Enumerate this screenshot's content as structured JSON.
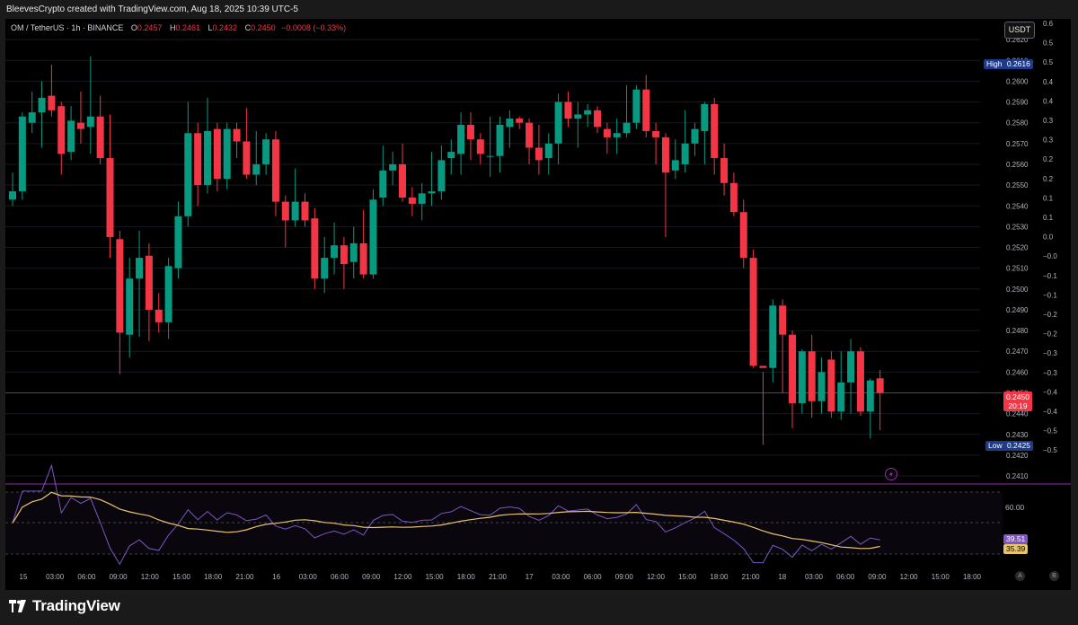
{
  "header": {
    "text": "BleevesCrypto created with TradingView.com, Aug 18, 2025 10:39 UTC-5"
  },
  "legend": {
    "symbol": "OM / TetherUS · 1h · BINANCE",
    "open_key": "O",
    "open": "0.2457",
    "high_key": "H",
    "high": "0.2461",
    "low_key": "L",
    "low": "0.2432",
    "close_key": "C",
    "close": "0.2450",
    "change": "−0.0008 (−0.33%)"
  },
  "currency_button": "USDT",
  "tags": {
    "high_label": "High",
    "high_value": "0.2616",
    "low_label": "Low",
    "low_value": "0.2425",
    "last_price": "0.2450",
    "countdown": "20:19",
    "rsi_value": "39.51",
    "rsi_ma_value": "35.39",
    "rsi_level": "60.00"
  },
  "price_axis": [
    "0.2620",
    "0.2610",
    "0.2600",
    "0.2590",
    "0.2580",
    "0.2570",
    "0.2560",
    "0.2550",
    "0.2540",
    "0.2530",
    "0.2520",
    "0.2510",
    "0.2500",
    "0.2490",
    "0.2480",
    "0.2470",
    "0.2460",
    "0.2450",
    "0.2440",
    "0.2430",
    "0.2420",
    "0.2410"
  ],
  "right_axis": [
    "0.6",
    "0.5",
    "0.5",
    "0.4",
    "0.4",
    "0.3",
    "0.3",
    "0.2",
    "0.2",
    "0.1",
    "0.1",
    "0.0",
    "−0.0",
    "−0.1",
    "−0.1",
    "−0.2",
    "−0.2",
    "−0.3",
    "−0.3",
    "−0.4",
    "−0.4",
    "−0.5",
    "−0.5"
  ],
  "time_axis": [
    "15",
    "03:00",
    "06:00",
    "09:00",
    "12:00",
    "15:00",
    "18:00",
    "21:00",
    "16",
    "03:00",
    "06:00",
    "09:00",
    "12:00",
    "15:00",
    "18:00",
    "21:00",
    "17",
    "03:00",
    "06:00",
    "09:00",
    "12:00",
    "15:00",
    "18:00",
    "21:00",
    "18",
    "03:00",
    "06:00",
    "09:00",
    "12:00",
    "15:00",
    "18:00"
  ],
  "bottom_buttons": [
    "A",
    "B"
  ],
  "brand": "TradingView",
  "colors": {
    "up": "#089981",
    "down": "#f23645",
    "rsi": "#7e57c2",
    "rsi_ma": "#e9c46a"
  },
  "chart_data": {
    "type": "candlestick",
    "interval": "1h",
    "candles": [
      {
        "o": 0.2543,
        "h": 0.2556,
        "l": 0.254,
        "c": 0.2547
      },
      {
        "o": 0.2547,
        "h": 0.2585,
        "l": 0.2543,
        "c": 0.2583
      },
      {
        "o": 0.258,
        "h": 0.2595,
        "l": 0.2575,
        "c": 0.2585
      },
      {
        "o": 0.2585,
        "h": 0.26,
        "l": 0.2568,
        "c": 0.2592
      },
      {
        "o": 0.2593,
        "h": 0.2608,
        "l": 0.2583,
        "c": 0.2586
      },
      {
        "o": 0.2588,
        "h": 0.259,
        "l": 0.2555,
        "c": 0.2565
      },
      {
        "o": 0.2566,
        "h": 0.2588,
        "l": 0.2562,
        "c": 0.2581
      },
      {
        "o": 0.258,
        "h": 0.2595,
        "l": 0.257,
        "c": 0.2577
      },
      {
        "o": 0.2578,
        "h": 0.2612,
        "l": 0.2565,
        "c": 0.2583
      },
      {
        "o": 0.2583,
        "h": 0.2593,
        "l": 0.256,
        "c": 0.2563
      },
      {
        "o": 0.2563,
        "h": 0.2584,
        "l": 0.2515,
        "c": 0.2525
      },
      {
        "o": 0.2524,
        "h": 0.2528,
        "l": 0.2459,
        "c": 0.2479
      },
      {
        "o": 0.2478,
        "h": 0.2515,
        "l": 0.2467,
        "c": 0.2505
      },
      {
        "o": 0.2505,
        "h": 0.2528,
        "l": 0.2477,
        "c": 0.2515
      },
      {
        "o": 0.2516,
        "h": 0.2522,
        "l": 0.2475,
        "c": 0.249
      },
      {
        "o": 0.249,
        "h": 0.2498,
        "l": 0.2479,
        "c": 0.2484
      },
      {
        "o": 0.2484,
        "h": 0.2515,
        "l": 0.2476,
        "c": 0.2511
      },
      {
        "o": 0.251,
        "h": 0.2542,
        "l": 0.2505,
        "c": 0.2535
      },
      {
        "o": 0.2535,
        "h": 0.259,
        "l": 0.253,
        "c": 0.2575
      },
      {
        "o": 0.2575,
        "h": 0.258,
        "l": 0.254,
        "c": 0.255
      },
      {
        "o": 0.255,
        "h": 0.2592,
        "l": 0.2546,
        "c": 0.2576
      },
      {
        "o": 0.2577,
        "h": 0.258,
        "l": 0.2547,
        "c": 0.2553
      },
      {
        "o": 0.2553,
        "h": 0.258,
        "l": 0.2548,
        "c": 0.2577
      },
      {
        "o": 0.2577,
        "h": 0.258,
        "l": 0.2563,
        "c": 0.2571
      },
      {
        "o": 0.2571,
        "h": 0.2587,
        "l": 0.2553,
        "c": 0.2555
      },
      {
        "o": 0.2555,
        "h": 0.2576,
        "l": 0.255,
        "c": 0.256
      },
      {
        "o": 0.256,
        "h": 0.2575,
        "l": 0.2555,
        "c": 0.2572
      },
      {
        "o": 0.2572,
        "h": 0.2576,
        "l": 0.2535,
        "c": 0.2542
      },
      {
        "o": 0.2542,
        "h": 0.2545,
        "l": 0.252,
        "c": 0.2533
      },
      {
        "o": 0.2533,
        "h": 0.2558,
        "l": 0.253,
        "c": 0.2542
      },
      {
        "o": 0.2542,
        "h": 0.2546,
        "l": 0.253,
        "c": 0.2533
      },
      {
        "o": 0.2534,
        "h": 0.2539,
        "l": 0.25,
        "c": 0.2505
      },
      {
        "o": 0.2505,
        "h": 0.2525,
        "l": 0.2498,
        "c": 0.2515
      },
      {
        "o": 0.2515,
        "h": 0.2532,
        "l": 0.2507,
        "c": 0.2521
      },
      {
        "o": 0.2521,
        "h": 0.2525,
        "l": 0.25,
        "c": 0.2512
      },
      {
        "o": 0.2513,
        "h": 0.253,
        "l": 0.2505,
        "c": 0.2522
      },
      {
        "o": 0.2522,
        "h": 0.2538,
        "l": 0.2505,
        "c": 0.2507
      },
      {
        "o": 0.2507,
        "h": 0.2548,
        "l": 0.2505,
        "c": 0.2543
      },
      {
        "o": 0.2544,
        "h": 0.2569,
        "l": 0.254,
        "c": 0.2557
      },
      {
        "o": 0.2557,
        "h": 0.2566,
        "l": 0.255,
        "c": 0.256
      },
      {
        "o": 0.256,
        "h": 0.257,
        "l": 0.2542,
        "c": 0.2544
      },
      {
        "o": 0.2544,
        "h": 0.2549,
        "l": 0.2535,
        "c": 0.2541
      },
      {
        "o": 0.2541,
        "h": 0.2551,
        "l": 0.2533,
        "c": 0.2546
      },
      {
        "o": 0.2546,
        "h": 0.2566,
        "l": 0.254,
        "c": 0.2547
      },
      {
        "o": 0.2547,
        "h": 0.2569,
        "l": 0.2543,
        "c": 0.2562
      },
      {
        "o": 0.2563,
        "h": 0.2572,
        "l": 0.2555,
        "c": 0.2566
      },
      {
        "o": 0.2565,
        "h": 0.2585,
        "l": 0.2555,
        "c": 0.2579
      },
      {
        "o": 0.2579,
        "h": 0.2585,
        "l": 0.2562,
        "c": 0.2572
      },
      {
        "o": 0.2572,
        "h": 0.2575,
        "l": 0.256,
        "c": 0.2565
      },
      {
        "o": 0.2564,
        "h": 0.2583,
        "l": 0.2554,
        "c": 0.2564
      },
      {
        "o": 0.2564,
        "h": 0.2583,
        "l": 0.2556,
        "c": 0.2579
      },
      {
        "o": 0.2578,
        "h": 0.2586,
        "l": 0.2568,
        "c": 0.2582
      },
      {
        "o": 0.2582,
        "h": 0.2583,
        "l": 0.2577,
        "c": 0.258
      },
      {
        "o": 0.258,
        "h": 0.2582,
        "l": 0.256,
        "c": 0.2568
      },
      {
        "o": 0.2568,
        "h": 0.2579,
        "l": 0.2555,
        "c": 0.2562
      },
      {
        "o": 0.2563,
        "h": 0.2575,
        "l": 0.2555,
        "c": 0.257
      },
      {
        "o": 0.257,
        "h": 0.2594,
        "l": 0.256,
        "c": 0.259
      },
      {
        "o": 0.259,
        "h": 0.2595,
        "l": 0.2578,
        "c": 0.2582
      },
      {
        "o": 0.2582,
        "h": 0.259,
        "l": 0.2568,
        "c": 0.2584
      },
      {
        "o": 0.2584,
        "h": 0.2589,
        "l": 0.2578,
        "c": 0.2586
      },
      {
        "o": 0.2586,
        "h": 0.2588,
        "l": 0.2575,
        "c": 0.2578
      },
      {
        "o": 0.2577,
        "h": 0.258,
        "l": 0.2565,
        "c": 0.2573
      },
      {
        "o": 0.2573,
        "h": 0.2582,
        "l": 0.2565,
        "c": 0.2575
      },
      {
        "o": 0.2575,
        "h": 0.2598,
        "l": 0.2573,
        "c": 0.258
      },
      {
        "o": 0.258,
        "h": 0.2598,
        "l": 0.2577,
        "c": 0.2596
      },
      {
        "o": 0.2596,
        "h": 0.2603,
        "l": 0.2573,
        "c": 0.2576
      },
      {
        "o": 0.2576,
        "h": 0.258,
        "l": 0.256,
        "c": 0.2573
      },
      {
        "o": 0.2573,
        "h": 0.2575,
        "l": 0.2525,
        "c": 0.2556
      },
      {
        "o": 0.2557,
        "h": 0.2572,
        "l": 0.2553,
        "c": 0.2562
      },
      {
        "o": 0.256,
        "h": 0.2586,
        "l": 0.2556,
        "c": 0.257
      },
      {
        "o": 0.257,
        "h": 0.258,
        "l": 0.2564,
        "c": 0.2577
      },
      {
        "o": 0.2576,
        "h": 0.259,
        "l": 0.256,
        "c": 0.2589
      },
      {
        "o": 0.2589,
        "h": 0.2592,
        "l": 0.2555,
        "c": 0.2563
      },
      {
        "o": 0.2563,
        "h": 0.257,
        "l": 0.2545,
        "c": 0.2551
      },
      {
        "o": 0.2551,
        "h": 0.2556,
        "l": 0.2535,
        "c": 0.2537
      },
      {
        "o": 0.2537,
        "h": 0.2543,
        "l": 0.251,
        "c": 0.2515
      },
      {
        "o": 0.2515,
        "h": 0.2519,
        "l": 0.2462,
        "c": 0.2463
      },
      {
        "o": 0.2463,
        "h": 0.246,
        "l": 0.2425,
        "c": 0.2462
      },
      {
        "o": 0.2462,
        "h": 0.2495,
        "l": 0.2455,
        "c": 0.2492
      },
      {
        "o": 0.2492,
        "h": 0.2495,
        "l": 0.245,
        "c": 0.2478
      },
      {
        "o": 0.2478,
        "h": 0.248,
        "l": 0.2433,
        "c": 0.2445
      },
      {
        "o": 0.2445,
        "h": 0.2471,
        "l": 0.244,
        "c": 0.247
      },
      {
        "o": 0.247,
        "h": 0.2478,
        "l": 0.2438,
        "c": 0.2446
      },
      {
        "o": 0.2446,
        "h": 0.2467,
        "l": 0.244,
        "c": 0.246
      },
      {
        "o": 0.2466,
        "h": 0.247,
        "l": 0.2438,
        "c": 0.2441
      },
      {
        "o": 0.2441,
        "h": 0.247,
        "l": 0.2437,
        "c": 0.2455
      },
      {
        "o": 0.2455,
        "h": 0.2476,
        "l": 0.244,
        "c": 0.247
      },
      {
        "o": 0.247,
        "h": 0.2472,
        "l": 0.2439,
        "c": 0.2441
      },
      {
        "o": 0.2441,
        "h": 0.2457,
        "l": 0.2428,
        "c": 0.2456
      },
      {
        "o": 0.2457,
        "h": 0.2461,
        "l": 0.2432,
        "c": 0.245
      }
    ],
    "price_range": [
      0.2407,
      0.263
    ],
    "high_marker": 0.2616,
    "low_marker": 0.2425,
    "last_price": 0.245,
    "rsi_level": 60.0,
    "rsi_last": 39.51,
    "rsi_ma_last": 35.39
  }
}
